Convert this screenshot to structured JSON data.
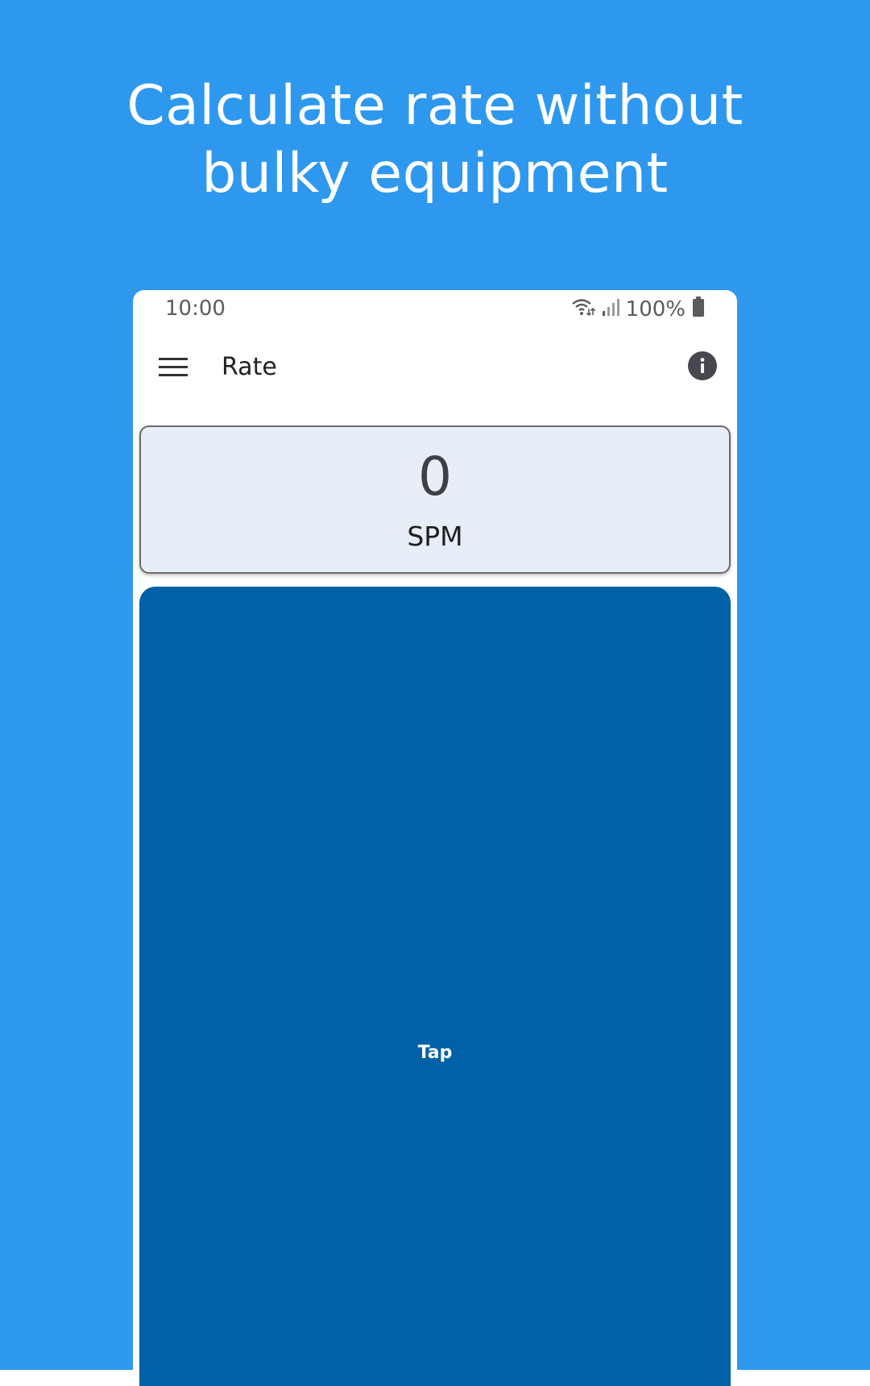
{
  "colors": {
    "background": "#2e98ef",
    "phone_surface": "#ffffff",
    "card_background": "#e7eef7",
    "tap_area": "#0061a6",
    "info_icon": "#48464f"
  },
  "headline": {
    "line1": "Calculate rate without",
    "line2": "bulky equipment"
  },
  "status_bar": {
    "time": "10:00",
    "battery": "100%",
    "icons": [
      "wifi-icon",
      "signal-icon",
      "battery-icon"
    ]
  },
  "app_bar": {
    "title": "Rate",
    "menu_icon": "hamburger-menu-icon",
    "info_icon": "info-icon"
  },
  "rate_display": {
    "value": "0",
    "unit": "SPM"
  },
  "tap_area": {
    "label": "Tap"
  }
}
